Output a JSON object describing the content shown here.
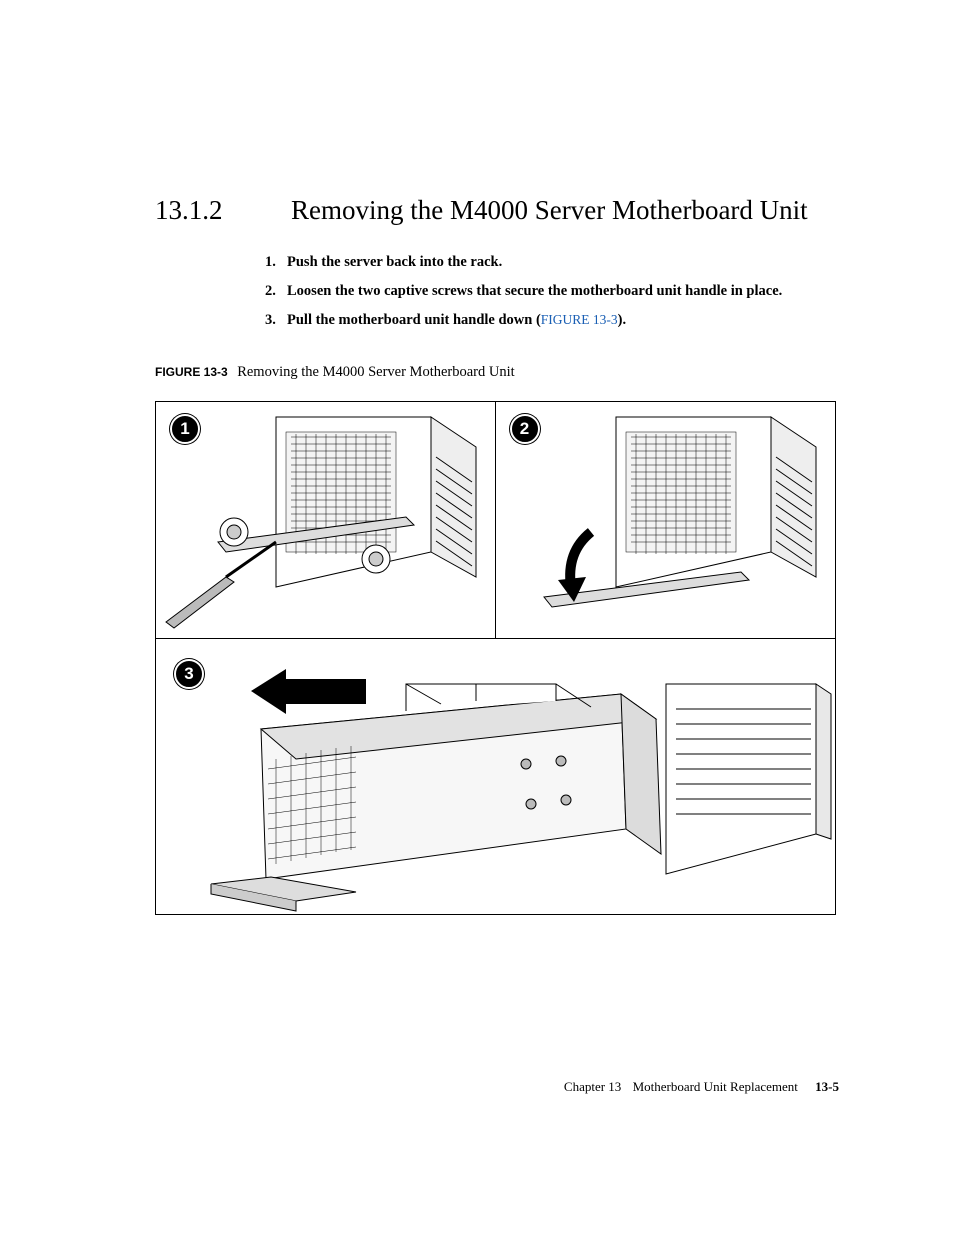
{
  "heading": {
    "number": "13.1.2",
    "title": "Removing the M4000 Server Motherboard Unit"
  },
  "steps": [
    {
      "num": "1.",
      "text": "Push the server back into the rack."
    },
    {
      "num": "2.",
      "text": "Loosen the two captive screws that secure the motherboard unit handle in place."
    },
    {
      "num": "3.",
      "text_pre": "Pull the motherboard unit handle down (",
      "link": "FIGURE 13-3",
      "text_post": ")."
    }
  ],
  "figure": {
    "label": "FIGURE 13-3",
    "title": "Removing the M4000 Server Motherboard Unit",
    "callouts": [
      "1",
      "2",
      "3"
    ]
  },
  "footer": {
    "chapter": "Chapter 13",
    "title": "Motherboard Unit Replacement",
    "page": "13-5"
  }
}
